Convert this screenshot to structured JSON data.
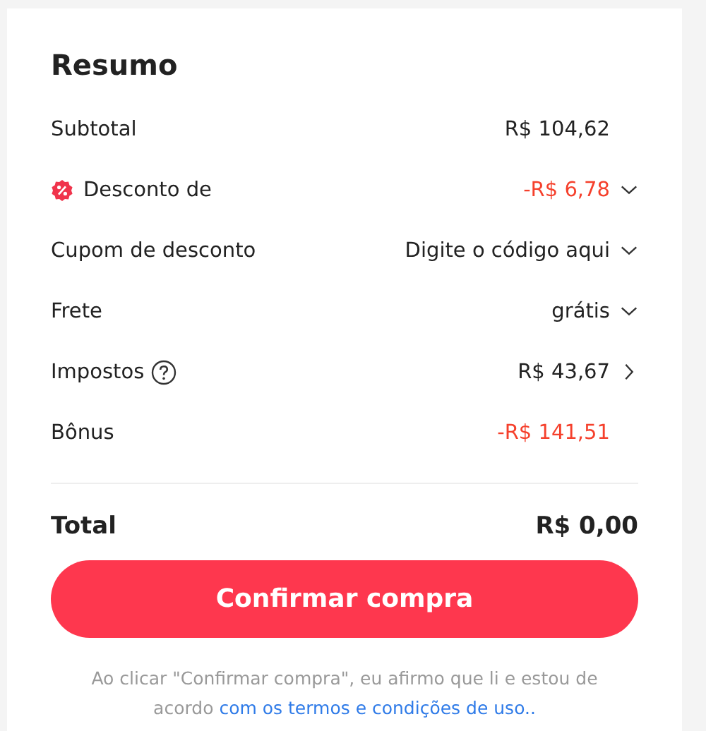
{
  "title": "Resumo",
  "rows": [
    {
      "kind": "plain",
      "label": "Subtotal",
      "value": "R$ 104,62",
      "negative": false
    },
    {
      "kind": "discount",
      "label": "Desconto de",
      "value": "-R$ 6,78",
      "negative": true
    },
    {
      "kind": "dropdown",
      "label": "Cupom de desconto",
      "value": "Digite o código aqui",
      "negative": false
    },
    {
      "kind": "dropdown",
      "label": "Frete",
      "value": "grátis",
      "negative": false
    },
    {
      "kind": "info",
      "label": "Impostos",
      "value": "R$ 43,67",
      "negative": false
    },
    {
      "kind": "plain",
      "label": "Bônus",
      "value": "-R$ 141,51",
      "negative": true
    }
  ],
  "total": {
    "label": "Total",
    "value": "R$ 0,00"
  },
  "button": "Confirmar compra",
  "footer": {
    "text": "Ao clicar \"Confirmar compra\", eu afirmo que li e estou de acordo",
    "link": "com os termos e condições de uso.."
  }
}
